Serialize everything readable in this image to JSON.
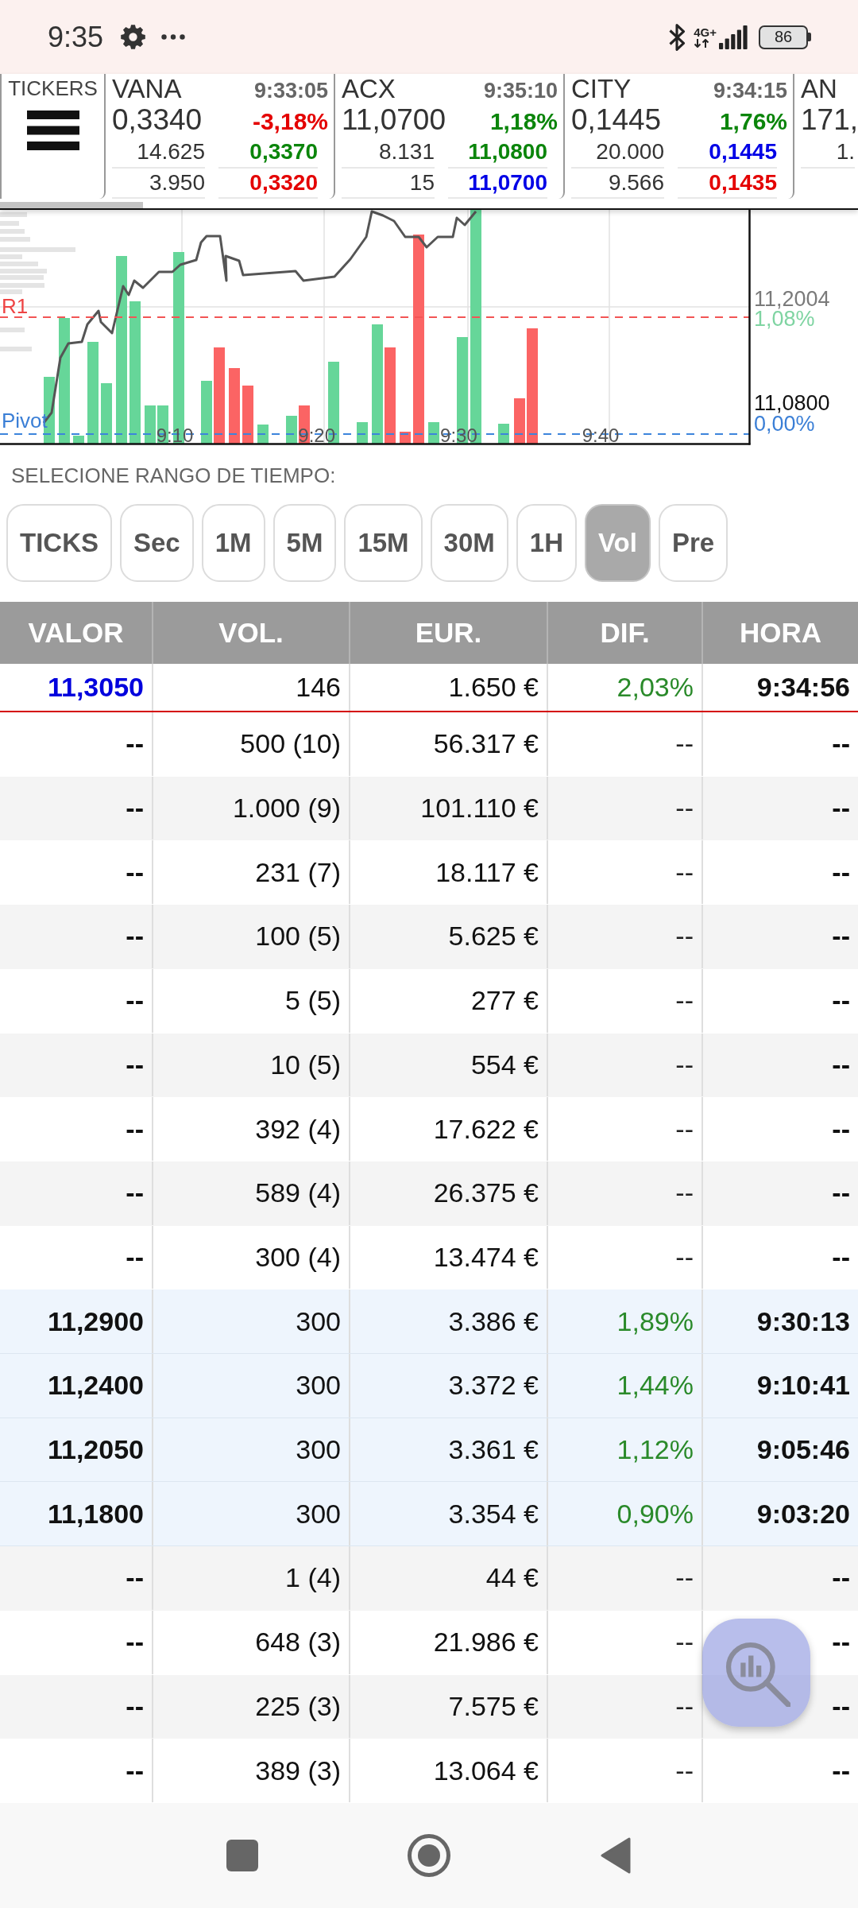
{
  "status_bar": {
    "time": "9:35",
    "network": "4G+",
    "battery": "86"
  },
  "tickers": {
    "label": "TICKERS",
    "items": [
      {
        "symbol": "VANA",
        "time": "9:33:05",
        "price": "0,3340",
        "change": "-3,18%",
        "color": "#e40000",
        "quotes": [
          {
            "volume": "14.625",
            "price": "0,3370",
            "color": "#0b850b"
          },
          {
            "volume": "3.950",
            "price": "0,3320",
            "color": "#e40000"
          }
        ]
      },
      {
        "symbol": "ACX",
        "time": "9:35:10",
        "price": "11,0700",
        "change": "1,18%",
        "color": "#0b850b",
        "quotes": [
          {
            "volume": "8.131",
            "price": "11,0800",
            "color": "#0b850b"
          },
          {
            "volume": "15",
            "price": "11,0700",
            "color": "#0000e6"
          }
        ]
      },
      {
        "symbol": "CITY",
        "time": "9:34:15",
        "price": "0,1445",
        "change": "1,76%",
        "color": "#0b850b",
        "quotes": [
          {
            "volume": "20.000",
            "price": "0,1445",
            "color": "#0000e6"
          },
          {
            "volume": "9.566",
            "price": "0,1435",
            "color": "#e40000"
          }
        ]
      },
      {
        "symbol": "AN",
        "price": "171,",
        "quotes": [
          {
            "volume": "1."
          }
        ]
      }
    ]
  },
  "chart": {
    "levels": [
      {
        "kind": "resistance",
        "name": "R1",
        "price": "11,2004",
        "change": "1,08%"
      },
      {
        "kind": "pivot",
        "name": "Pivot",
        "price": "11,0800",
        "change": "0,00%"
      }
    ],
    "time_labels": [
      "9:10",
      "9:20",
      "9:30",
      "9:40"
    ]
  },
  "time_range": {
    "label": "SELECIONE RANGO DE TIEMPO:",
    "options": [
      {
        "label": "TICKS",
        "selected": false
      },
      {
        "label": "Sec",
        "selected": false
      },
      {
        "label": "1M",
        "selected": false
      },
      {
        "label": "5M",
        "selected": false
      },
      {
        "label": "15M",
        "selected": false
      },
      {
        "label": "30M",
        "selected": false
      },
      {
        "label": "1H",
        "selected": false
      },
      {
        "label": "Vol",
        "selected": true
      },
      {
        "label": "Pre",
        "selected": false
      }
    ]
  },
  "table": {
    "columns": [
      "VALOR",
      "VOL.",
      "EUR.",
      "DIF.",
      "HORA"
    ],
    "last_trade": {
      "cells": [
        "11,3050",
        "146",
        "1.650 €",
        "2,03%",
        "9:34:56"
      ]
    },
    "rows": [
      {
        "kind": "order",
        "cells": [
          "--",
          "500 (10)",
          "56.317 €",
          "--",
          "--"
        ]
      },
      {
        "kind": "order",
        "cells": [
          "--",
          "1.000 (9)",
          "101.110 €",
          "--",
          "--"
        ]
      },
      {
        "kind": "order",
        "cells": [
          "--",
          "231 (7)",
          "18.117 €",
          "--",
          "--"
        ]
      },
      {
        "kind": "order",
        "cells": [
          "--",
          "100 (5)",
          "5.625 €",
          "--",
          "--"
        ]
      },
      {
        "kind": "order",
        "cells": [
          "--",
          "5 (5)",
          "277 €",
          "--",
          "--"
        ]
      },
      {
        "kind": "order",
        "cells": [
          "--",
          "10 (5)",
          "554 €",
          "--",
          "--"
        ]
      },
      {
        "kind": "order",
        "cells": [
          "--",
          "392 (4)",
          "17.622 €",
          "--",
          "--"
        ]
      },
      {
        "kind": "order",
        "cells": [
          "--",
          "589 (4)",
          "26.375 €",
          "--",
          "--"
        ]
      },
      {
        "kind": "order",
        "cells": [
          "--",
          "300 (4)",
          "13.474 €",
          "--",
          "--"
        ]
      },
      {
        "kind": "trade",
        "cells": [
          "11,2900",
          "300",
          "3.386 €",
          "1,89%",
          "9:30:13"
        ]
      },
      {
        "kind": "trade",
        "cells": [
          "11,2400",
          "300",
          "3.372 €",
          "1,44%",
          "9:10:41"
        ]
      },
      {
        "kind": "trade",
        "cells": [
          "11,2050",
          "300",
          "3.361 €",
          "1,12%",
          "9:05:46"
        ]
      },
      {
        "kind": "trade",
        "cells": [
          "11,1800",
          "300",
          "3.354 €",
          "0,90%",
          "9:03:20"
        ]
      },
      {
        "kind": "order",
        "cells": [
          "--",
          "1 (4)",
          "44 €",
          "--",
          "--"
        ]
      },
      {
        "kind": "order",
        "cells": [
          "--",
          "648 (3)",
          "21.986 €",
          "--",
          "--"
        ]
      },
      {
        "kind": "order",
        "cells": [
          "--",
          "225 (3)",
          "7.575 €",
          "--",
          "--"
        ]
      },
      {
        "kind": "order",
        "cells": [
          "--",
          "389 (3)",
          "13.064 €",
          "--",
          "--"
        ]
      }
    ]
  }
}
